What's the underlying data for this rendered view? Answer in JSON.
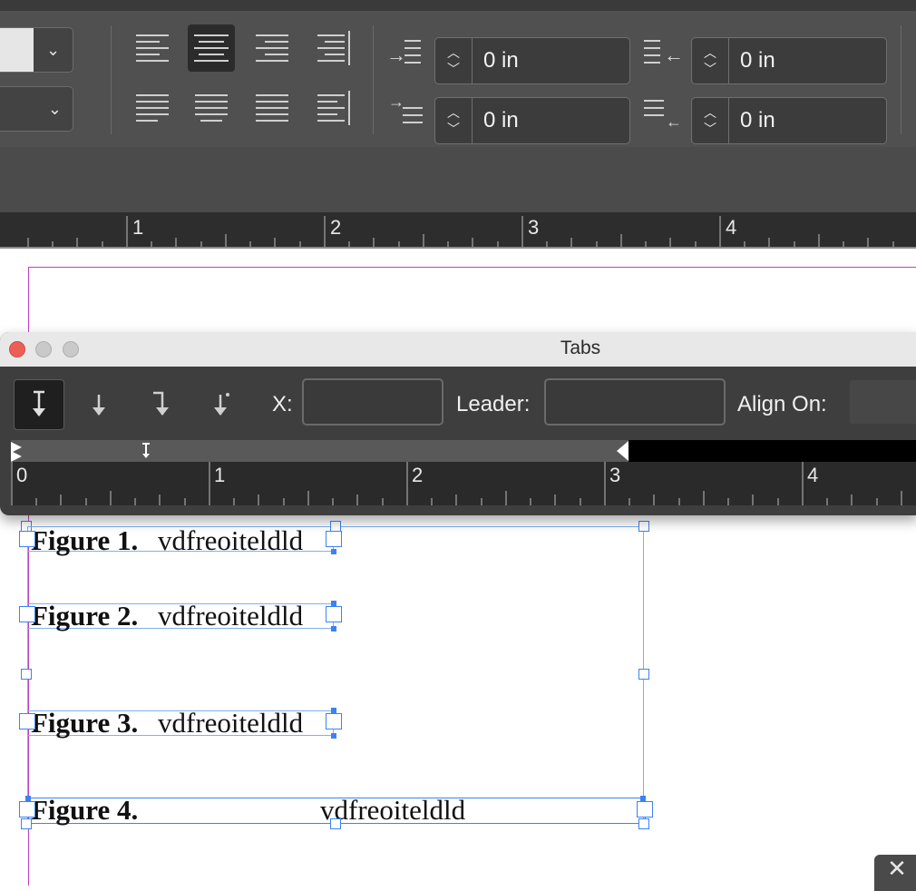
{
  "control_panel": {
    "indent_left": "0 in",
    "indent_right": "0 in",
    "first_line_indent": "0 in",
    "last_line_indent": "0 in"
  },
  "ruler": {
    "numbers": [
      "1",
      "2",
      "3",
      "4"
    ]
  },
  "tabs_dialog": {
    "title": "Tabs",
    "x_label": "X:",
    "x_value": "",
    "leader_label": "Leader:",
    "leader_value": "",
    "align_on_label": "Align On:",
    "ruler_numbers": [
      "0",
      "1",
      "2",
      "3",
      "4"
    ]
  },
  "document": {
    "figures": [
      {
        "label": "Figure 1.",
        "text": "vdfreoiteldld"
      },
      {
        "label": "Figure 2.",
        "text": "vdfreoiteldld"
      },
      {
        "label": "Figure 3.",
        "text": "vdfreoiteldld"
      },
      {
        "label": "Figure 4.",
        "text": "vdfreoiteldld"
      }
    ]
  },
  "colors": {
    "accent": "#3b82f6",
    "margin_guide": "#c040c0",
    "panel": "#505050"
  }
}
